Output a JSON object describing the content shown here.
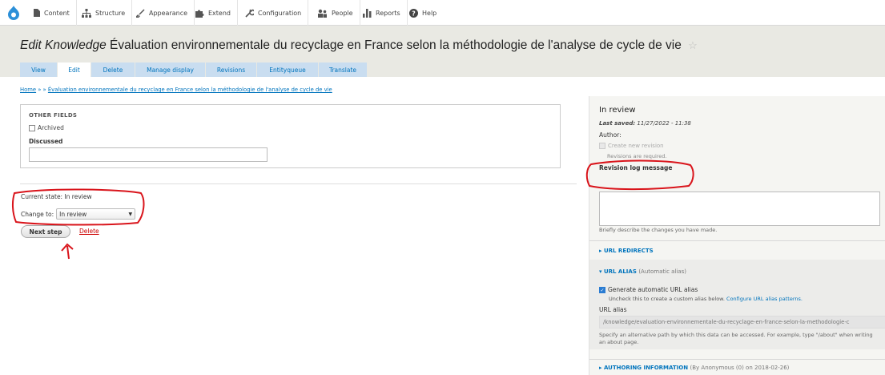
{
  "toolbar": {
    "items": [
      {
        "label": "Content",
        "icon": "file-icon"
      },
      {
        "label": "Structure",
        "icon": "structure-icon"
      },
      {
        "label": "Appearance",
        "icon": "brush-icon"
      },
      {
        "label": "Extend",
        "icon": "puzzle-icon"
      },
      {
        "label": "Configuration",
        "icon": "wrench-icon"
      },
      {
        "label": "People",
        "icon": "people-icon"
      },
      {
        "label": "Reports",
        "icon": "bar-chart-icon"
      },
      {
        "label": "Help",
        "icon": "help-icon"
      }
    ]
  },
  "page": {
    "title_prefix": "Edit Knowledge",
    "title": "Évaluation environnementale du recyclage en France selon la méthodologie de l'analyse de cycle de vie"
  },
  "tabs": [
    "View",
    "Edit",
    "Delete",
    "Manage display",
    "Revisions",
    "Entityqueue",
    "Translate"
  ],
  "breadcrumb": {
    "home": "Home",
    "sep": " » » ",
    "current": "Évaluation environnementale du recyclage en France selon la méthodologie de l'analyse de cycle de vie"
  },
  "other_fields": {
    "legend": "OTHER FIELDS",
    "archived_label": "Archived",
    "discussed_label": "Discussed"
  },
  "moderation": {
    "current_state": "Current state: In review",
    "change_to_label": "Change to:",
    "selected_state": "In review",
    "next_step_button": "Next step",
    "delete_link": "Delete"
  },
  "sidebar": {
    "state_title": "In review",
    "last_saved_label": "Last saved:",
    "last_saved_value": "11/27/2022 - 11:38",
    "author_label": "Author:",
    "create_revision_label": "Create new revision",
    "revisions_required": "Revisions are required.",
    "revision_log_label": "Revision log message",
    "revision_log_help": "Briefly describe the changes you have made.",
    "url_redirects": "URL REDIRECTS",
    "url_alias_heading": "URL ALIAS",
    "url_alias_note": "(Automatic alias)",
    "generate_alias_label": "Generate automatic URL alias",
    "uncheck_text": "Uncheck this to create a custom alias below.",
    "configure_link": "Configure URL alias patterns.",
    "url_alias_label": "URL alias",
    "url_alias_value": "/knowledge/evaluation-environnementale-du-recyclage-en-france-selon-la-methodologie-c",
    "url_alias_help": "Specify an alternative path by which this data can be accessed. For example, type \"/about\" when writing an about page.",
    "authoring_heading": "AUTHORING INFORMATION",
    "authoring_note": "(By Anonymous (0) on 2018-02-26)"
  },
  "colors": {
    "link": "#0074bd",
    "annotation": "#d9141b",
    "header_bg": "#e9e9e3"
  }
}
